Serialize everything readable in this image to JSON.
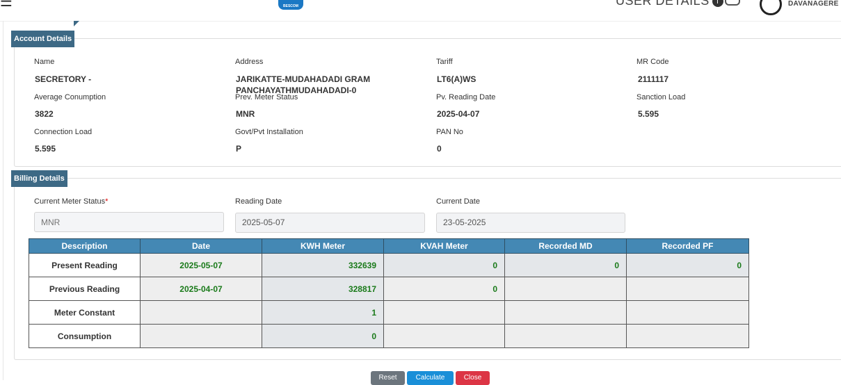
{
  "header": {
    "logo_text": "BESCOM",
    "user_details_label": "USER DETAILS",
    "office": "DAVANAGERE I"
  },
  "account": {
    "legend": "Account Details",
    "fields": {
      "name": {
        "label": "Name",
        "value": "SECRETORY -"
      },
      "address": {
        "label": "Address",
        "value": "JARIKATTE-MUDAHADADI GRAM PANCHAYATHMUDAHADADI-0"
      },
      "tariff": {
        "label": "Tariff",
        "value": "LT6(A)WS"
      },
      "mr_code": {
        "label": "MR Code",
        "value": "2111117"
      },
      "avg_consumption": {
        "label": "Average Conumption",
        "value": "3822"
      },
      "prev_meter_status": {
        "label": "Prev. Meter Status",
        "value": "MNR"
      },
      "pv_reading_date": {
        "label": "Pv. Reading Date",
        "value": "2025-04-07"
      },
      "sanction_load": {
        "label": "Sanction Load",
        "value": "5.595"
      },
      "connection_load": {
        "label": "Connection Load",
        "value": "5.595"
      },
      "installation": {
        "label": "Govt/Pvt Installation",
        "value": "P"
      },
      "pan_no": {
        "label": "PAN No",
        "value": "0"
      }
    }
  },
  "billing": {
    "legend": "Billing Details",
    "current_meter_status": {
      "label": "Current Meter Status",
      "required_mark": "*",
      "placeholder": "MNR"
    },
    "reading_date": {
      "label": "Reading Date",
      "value": "2025-05-07"
    },
    "current_date": {
      "label": "Current Date",
      "value": "23-05-2025"
    },
    "table": {
      "headers": [
        "Description",
        "Date",
        "KWH Meter",
        "KVAH Meter",
        "Recorded MD",
        "Recorded PF"
      ],
      "rows": [
        {
          "desc": "Present Reading",
          "date": "2025-05-07",
          "kwh": "332639",
          "kvah": "0",
          "md": "0",
          "pf": "0"
        },
        {
          "desc": "Previous Reading",
          "date": "2025-04-07",
          "kwh": "328817",
          "kvah": "0",
          "md": "",
          "pf": ""
        },
        {
          "desc": "Meter Constant",
          "date": "",
          "kwh": "1",
          "kvah": "",
          "md": "",
          "pf": ""
        },
        {
          "desc": "Consumption",
          "date": "",
          "kwh": "0",
          "kvah": "",
          "md": "",
          "pf": ""
        }
      ]
    }
  },
  "buttons": {
    "reset": "Reset",
    "calculate": "Calculate",
    "close": "Close"
  },
  "colors": {
    "legend_bg": "#3d6985",
    "table_header_bg": "#4488b4",
    "value_green": "#1a7a1a"
  }
}
